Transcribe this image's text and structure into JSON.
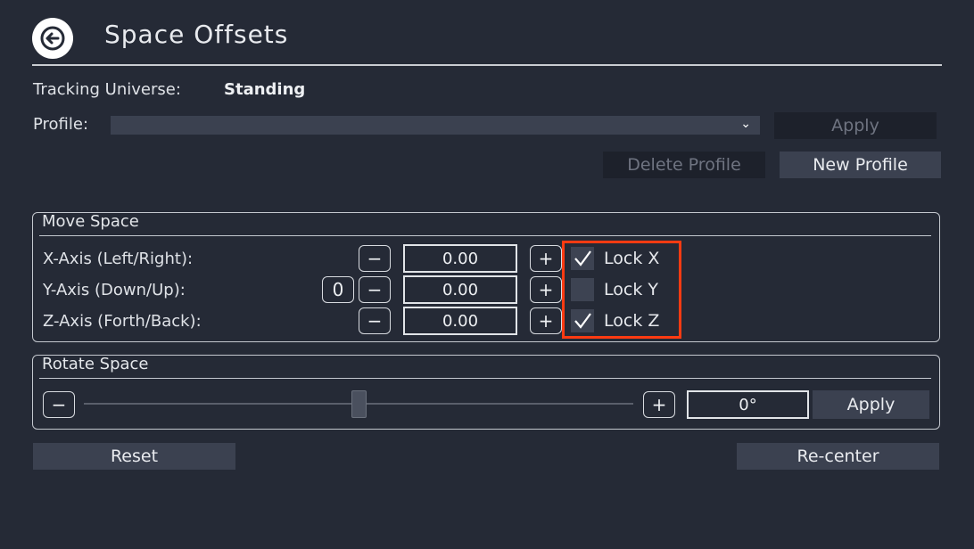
{
  "header": {
    "title": "Space Offsets",
    "back_icon": "back-arrow-icon"
  },
  "tracking": {
    "label": "Tracking Universe:",
    "value": "Standing"
  },
  "profile": {
    "label": "Profile:",
    "selected": "",
    "apply_label": "Apply",
    "delete_label": "Delete Profile",
    "new_label": "New Profile"
  },
  "move_space": {
    "title": "Move Space",
    "axes": [
      {
        "label": "X-Axis (Left/Right):",
        "value": "0.00",
        "lock_label": "Lock X",
        "locked": true
      },
      {
        "label": "Y-Axis (Down/Up):",
        "value": "0.00",
        "lock_label": "Lock Y",
        "locked": false,
        "reset_label": "0"
      },
      {
        "label": "Z-Axis (Forth/Back):",
        "value": "0.00",
        "lock_label": "Lock Z",
        "locked": true
      }
    ],
    "minus_label": "−",
    "plus_label": "+"
  },
  "rotate_space": {
    "title": "Rotate Space",
    "value": "0°",
    "slider_fraction": 0.5,
    "minus_label": "−",
    "plus_label": "+",
    "apply_label": "Apply"
  },
  "footer": {
    "reset_label": "Reset",
    "recenter_label": "Re-center"
  },
  "colors": {
    "background": "#252a36",
    "highlight": "#ff3b12",
    "button": "#3b4150"
  }
}
